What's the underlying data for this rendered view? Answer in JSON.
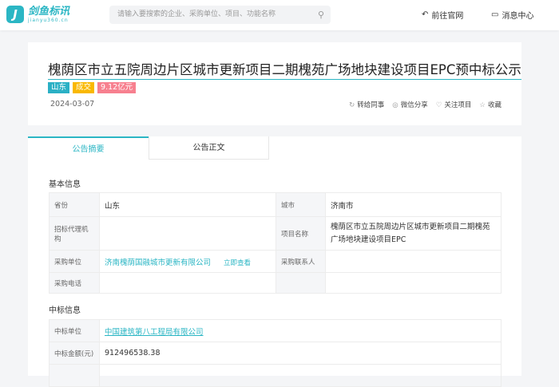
{
  "header": {
    "logo_text": "剑鱼标讯",
    "logo_domain": "jianyu360.cn",
    "search_placeholder": "请输入要搜索的企业、采购单位、项目、功能名称",
    "nav_home": "前往官网",
    "nav_messages": "消息中心"
  },
  "notice": {
    "title": "槐荫区市立五院周边片区城市更新项目二期槐苑广场地块建设项目EPC预中标公示",
    "tags": [
      "山东",
      "成交",
      "9.12亿元"
    ],
    "date": "2024-03-07",
    "actions": [
      "转给同事",
      "微信分享",
      "关注项目",
      "收藏"
    ]
  },
  "colors": {
    "accent": "#2bb6c4",
    "tag_region": "#2bb0c5",
    "tag_status": "#f9b800",
    "tag_amount": "#f7808f"
  },
  "tabs": [
    "公告摘要",
    "公告正文"
  ],
  "basic": {
    "heading": "基本信息",
    "province_label": "省份",
    "province": "山东",
    "city_label": "城市",
    "city": "济南市",
    "agency_label": "招标代理机构",
    "project_label": "项目名称",
    "project": "槐荫区市立五院周边片区城市更新项目二期槐苑广场地块建设项目EPC",
    "buyer_label": "采购单位",
    "buyer": "济南槐荫国融城市更新有限公司",
    "view_now": "立即查看",
    "contact_label": "采购联系人",
    "phone_label": "采购电话"
  },
  "winner": {
    "heading": "中标信息",
    "unit_label": "中标单位",
    "unit": "中国建筑第八工程局有限公司",
    "amount_label": "中标金额(元)",
    "amount": "912496538.38"
  }
}
